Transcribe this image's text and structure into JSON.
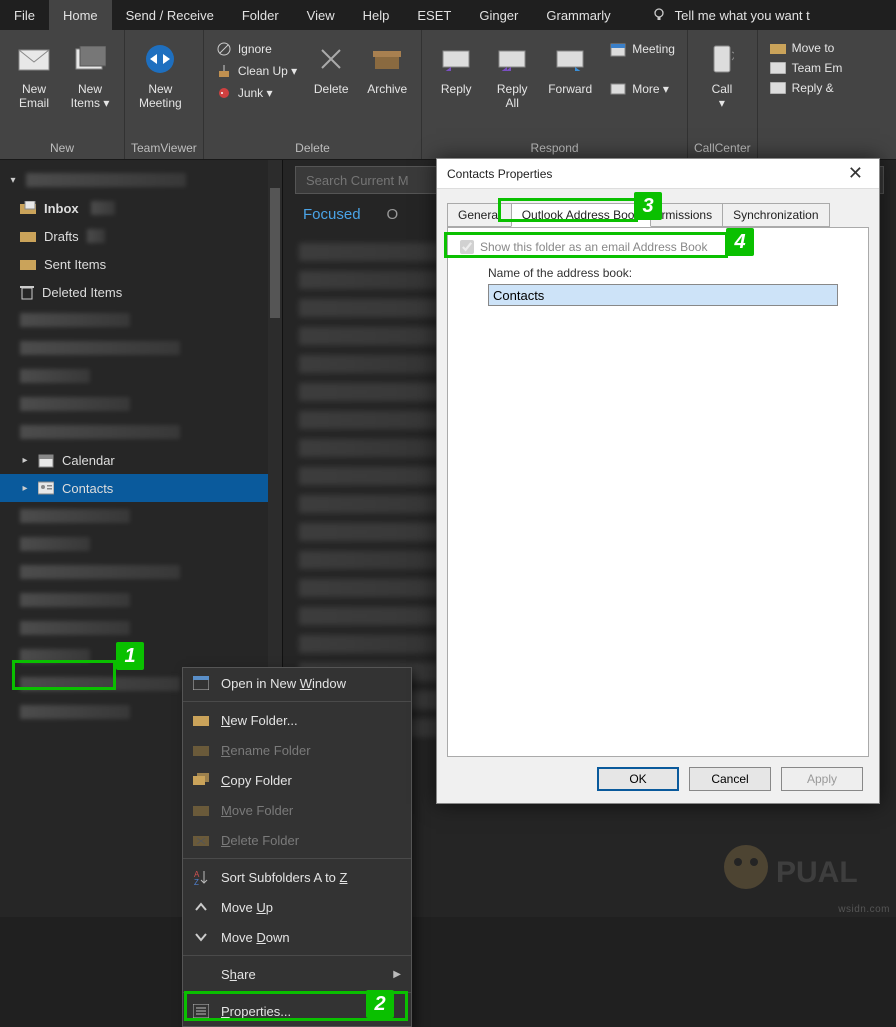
{
  "menubar": [
    "File",
    "Home",
    "Send / Receive",
    "Folder",
    "View",
    "Help",
    "ESET",
    "Ginger",
    "Grammarly"
  ],
  "menubar_active": 1,
  "tellme": "Tell me what you want t",
  "ribbon": {
    "groups": [
      {
        "label": "New",
        "buttons": [
          {
            "key": "new-email",
            "label": "New\nEmail"
          },
          {
            "key": "new-items",
            "label": "New\nItems ▾"
          }
        ]
      },
      {
        "label": "TeamViewer",
        "buttons": [
          {
            "key": "new-meeting",
            "label": "New\nMeeting"
          }
        ]
      },
      {
        "label": "Delete",
        "big": [
          {
            "key": "delete",
            "label": "Delete"
          },
          {
            "key": "archive",
            "label": "Archive"
          }
        ],
        "small": [
          {
            "key": "ignore",
            "label": "Ignore"
          },
          {
            "key": "cleanup",
            "label": "Clean Up ▾"
          },
          {
            "key": "junk",
            "label": "Junk ▾"
          }
        ]
      },
      {
        "label": "Respond",
        "big": [
          {
            "key": "reply",
            "label": "Reply"
          },
          {
            "key": "reply-all",
            "label": "Reply\nAll"
          },
          {
            "key": "forward",
            "label": "Forward"
          }
        ],
        "small": [
          {
            "key": "meeting",
            "label": "Meeting"
          },
          {
            "key": "more",
            "label": "More ▾"
          }
        ]
      },
      {
        "label": "CallCenter",
        "big": [
          {
            "key": "call",
            "label": "Call\n▾"
          }
        ]
      },
      {
        "label": "",
        "small": [
          {
            "key": "move-to",
            "label": "Move to"
          },
          {
            "key": "team-em",
            "label": "Team Em"
          },
          {
            "key": "reply-del",
            "label": "Reply &"
          }
        ]
      }
    ]
  },
  "sidebar": {
    "folders": [
      {
        "key": "inbox",
        "label": "Inbox",
        "icon": "inbox"
      },
      {
        "key": "drafts",
        "label": "Drafts",
        "icon": "folder"
      },
      {
        "key": "sent",
        "label": "Sent Items",
        "icon": "folder"
      },
      {
        "key": "deleted",
        "label": "Deleted Items",
        "icon": "trash"
      }
    ],
    "nav": [
      {
        "key": "calendar",
        "label": "Calendar",
        "icon": "calendar"
      },
      {
        "key": "contacts",
        "label": "Contacts",
        "icon": "contacts",
        "selected": true
      }
    ]
  },
  "search_placeholder": "Search Current M",
  "content_tabs": {
    "items": [
      "Focused",
      "O"
    ],
    "active": 0
  },
  "context_menu": [
    {
      "key": "open-new-window",
      "label": "Open in New Window",
      "u": "W",
      "icon": "window"
    },
    {
      "sep": true
    },
    {
      "key": "new-folder",
      "label": "New Folder...",
      "u": "N",
      "icon": "folder-new"
    },
    {
      "key": "rename-folder",
      "label": "Rename Folder",
      "u": "R",
      "icon": "rename",
      "disabled": true
    },
    {
      "key": "copy-folder",
      "label": "Copy Folder",
      "u": "C",
      "icon": "copy"
    },
    {
      "key": "move-folder",
      "label": "Move Folder",
      "u": "M",
      "icon": "move",
      "disabled": true
    },
    {
      "key": "delete-folder",
      "label": "Delete Folder",
      "u": "D",
      "icon": "delete",
      "disabled": true
    },
    {
      "sep": true
    },
    {
      "key": "sort-az",
      "label": "Sort Subfolders A to Z",
      "u": "Z",
      "icon": "sort"
    },
    {
      "key": "move-up",
      "label": "Move Up",
      "u": "U",
      "icon": "up"
    },
    {
      "key": "move-down",
      "label": "Move Down",
      "u": "D2",
      "icon": "down"
    },
    {
      "sep": true
    },
    {
      "key": "share",
      "label": "Share",
      "u": "h",
      "sub": true
    },
    {
      "sep": true
    },
    {
      "key": "properties",
      "label": "Properties...",
      "u": "P",
      "icon": "props"
    }
  ],
  "dialog": {
    "title": "Contacts Properties",
    "tabs": [
      "General",
      "Outlook Address Book",
      "rmissions",
      "Synchronization"
    ],
    "active_tab": 1,
    "checkbox_label": "Show this folder as an email Address Book",
    "checkbox_checked": true,
    "name_label": "Name of the address book:",
    "name_value": "Contacts",
    "buttons": {
      "ok": "OK",
      "cancel": "Cancel",
      "apply": "Apply"
    }
  },
  "annotations": {
    "1": "1",
    "2": "2",
    "3": "3",
    "4": "4"
  },
  "watermark": "wsidn.com"
}
